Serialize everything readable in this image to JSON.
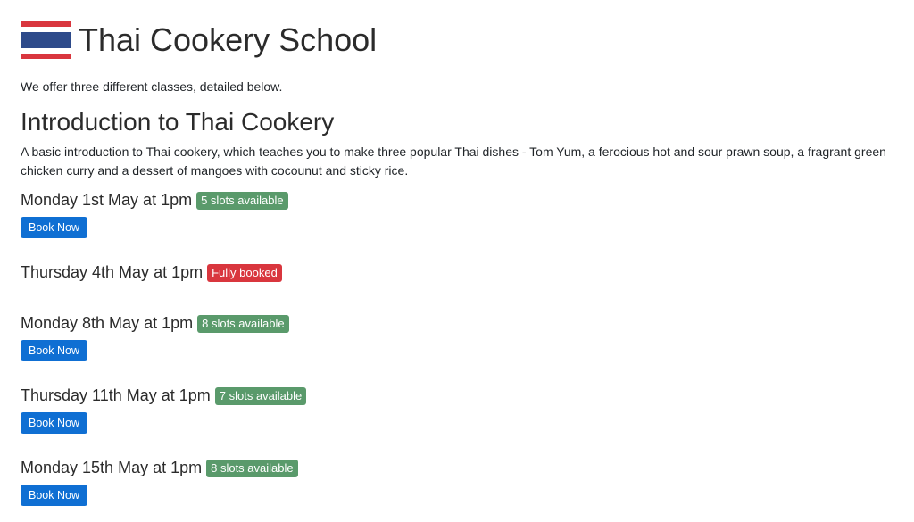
{
  "header": {
    "title": "Thai Cookery School",
    "flag_icon": "thai-flag-icon"
  },
  "intro_text": "We offer three different classes, detailed below.",
  "class": {
    "title": "Introduction to Thai Cookery",
    "description": "A basic introduction to Thai cookery, which teaches you to make three popular Thai dishes - Tom Yum, a ferocious hot and sour prawn soup, a fragrant green chicken curry and a dessert of mangoes with cocounut and sticky rice.",
    "sessions": [
      {
        "date": "Monday 1st May at 1pm",
        "badge": "5 slots available",
        "status": "available",
        "button": "Book Now"
      },
      {
        "date": "Thursday 4th May at 1pm",
        "badge": "Fully booked",
        "status": "full",
        "button": ""
      },
      {
        "date": "Monday 8th May at 1pm",
        "badge": "8 slots available",
        "status": "available",
        "button": "Book Now"
      },
      {
        "date": "Thursday 11th May at 1pm",
        "badge": "7 slots available",
        "status": "available",
        "button": "Book Now"
      },
      {
        "date": "Monday 15th May at 1pm",
        "badge": "8 slots available",
        "status": "available",
        "button": "Book Now"
      }
    ]
  },
  "colors": {
    "available": "#5a9a6b",
    "full": "#d9363e",
    "button": "#0f6fd3"
  }
}
